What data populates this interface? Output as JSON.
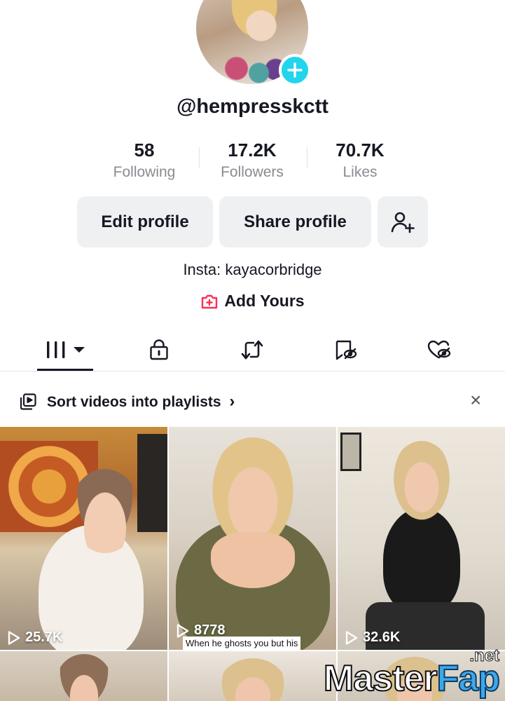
{
  "profile": {
    "username": "@hempresskctt",
    "bio": "Insta: kayacorbridge",
    "add_yours": "Add Yours"
  },
  "stats": {
    "following": {
      "value": "58",
      "label": "Following"
    },
    "followers": {
      "value": "17.2K",
      "label": "Followers"
    },
    "likes": {
      "value": "70.7K",
      "label": "Likes"
    }
  },
  "actions": {
    "edit": "Edit profile",
    "share": "Share profile"
  },
  "tabs": [
    "videos-grid",
    "private",
    "reposts",
    "favorites",
    "liked"
  ],
  "playlist_banner": {
    "text": "Sort videos into playlists",
    "chevron": "›",
    "close": "×"
  },
  "videos": [
    {
      "views": "25.7K",
      "caption": ""
    },
    {
      "views": "8778",
      "caption": "When he ghosts you but his"
    },
    {
      "views": "32.6K",
      "caption": ""
    }
  ],
  "watermark": {
    "main_a": "Master",
    "main_b": "Fap",
    "suffix": ".net"
  },
  "colors": {
    "accent_cyan": "#20d5ec",
    "brand_pink": "#fe2c55",
    "button_bg": "#eff0f2",
    "muted_text": "#8a8b91"
  }
}
